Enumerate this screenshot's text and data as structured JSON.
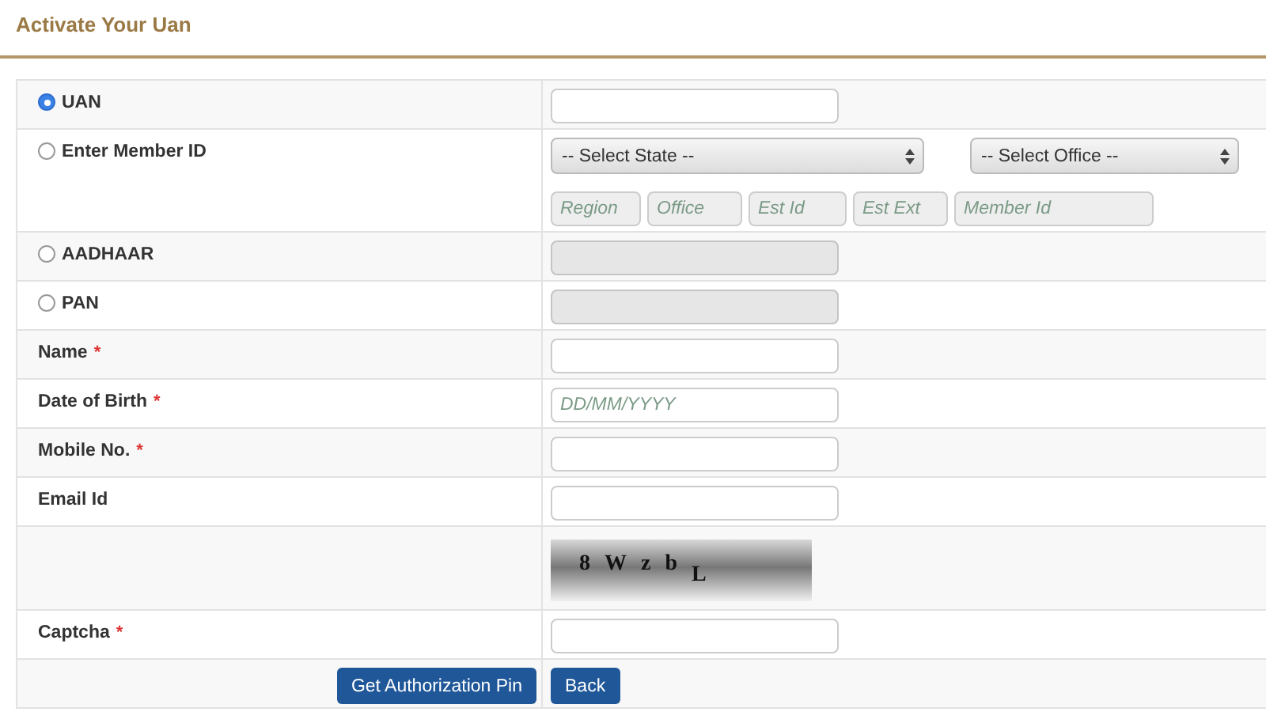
{
  "title": "Activate Your Uan",
  "rows": [
    {
      "kind": "radio",
      "label": "UAN",
      "selected": true,
      "field": {
        "disabled": false
      }
    },
    {
      "kind": "member",
      "label": "Enter Member ID",
      "selected": false,
      "selects": [
        "-- Select State --",
        "-- Select Office --"
      ],
      "fields": [
        {
          "placeholder": "Region",
          "disabled": true
        },
        {
          "placeholder": "Office",
          "disabled": true
        },
        {
          "placeholder": "Est Id",
          "disabled": true
        },
        {
          "placeholder": "Est Ext",
          "disabled": true
        },
        {
          "placeholder": "Member Id",
          "disabled": true
        }
      ]
    },
    {
      "kind": "radio",
      "label": "AADHAAR",
      "selected": false,
      "field": {
        "disabled": true
      }
    },
    {
      "kind": "radio",
      "label": "PAN",
      "selected": false,
      "field": {
        "disabled": true
      }
    },
    {
      "kind": "text",
      "label": "Name",
      "required_mark": "*",
      "field": {
        "disabled": false
      }
    },
    {
      "kind": "text",
      "label": "Date of Birth",
      "required_mark": "*",
      "field": {
        "placeholder": "DD/MM/YYYY",
        "disabled": false
      }
    },
    {
      "kind": "text",
      "label": "Mobile No.",
      "required_mark": "*",
      "field": {
        "disabled": false
      }
    },
    {
      "kind": "text",
      "label": "Email Id",
      "field": {
        "disabled": false
      }
    },
    {
      "kind": "captcha",
      "characters": [
        "8",
        "W",
        "z",
        "b",
        "L"
      ]
    },
    {
      "kind": "text",
      "label": "Captcha",
      "required_mark": "*",
      "field": {
        "disabled": false
      }
    },
    {
      "kind": "buttons",
      "buttons": [
        "Get Authorization Pin",
        "Back"
      ]
    }
  ]
}
